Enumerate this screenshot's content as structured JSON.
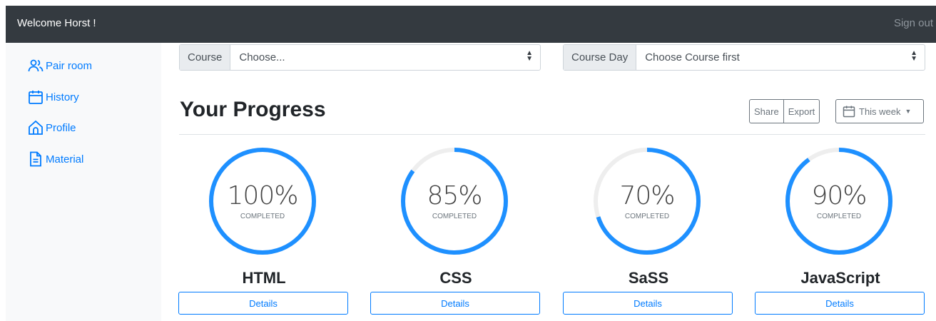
{
  "header": {
    "welcome": "Welcome Horst !",
    "signout": "Sign out"
  },
  "sidebar": {
    "items": [
      {
        "label": "Pair room",
        "icon": "people-icon"
      },
      {
        "label": "History",
        "icon": "calendar-icon"
      },
      {
        "label": "Profile",
        "icon": "house-icon"
      },
      {
        "label": "Material",
        "icon": "document-icon"
      }
    ]
  },
  "filters": {
    "course": {
      "prefix": "Course",
      "value": "Choose..."
    },
    "course_day": {
      "prefix": "Course Day",
      "value": "Choose Course first"
    }
  },
  "main": {
    "title": "Your Progress",
    "share_label": "Share",
    "export_label": "Export",
    "range_label": "This week"
  },
  "progress": [
    {
      "name": "HTML",
      "percent": 100,
      "percent_text": "100%",
      "sub": "COMPLETED",
      "button": "Details"
    },
    {
      "name": "CSS",
      "percent": 85,
      "percent_text": "85%",
      "sub": "COMPLETED",
      "button": "Details"
    },
    {
      "name": "SaSS",
      "percent": 70,
      "percent_text": "70%",
      "sub": "COMPLETED",
      "button": "Details"
    },
    {
      "name": "JavaScript",
      "percent": 90,
      "percent_text": "90%",
      "sub": "COMPLETED",
      "button": "Details"
    }
  ],
  "colors": {
    "accent": "#1e90ff",
    "track": "#eeeeee",
    "topbar": "#343a40",
    "link": "#007bff"
  }
}
